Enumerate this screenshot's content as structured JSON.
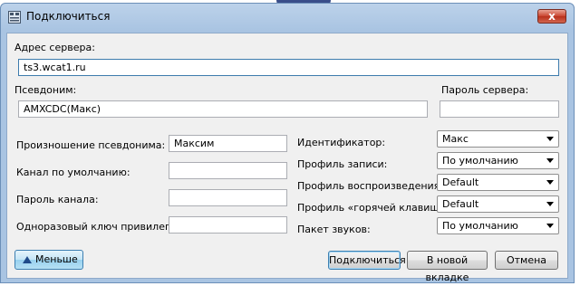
{
  "window": {
    "title": "Подключиться",
    "close_symbol": "x"
  },
  "server_address": {
    "label": "Адрес сервера:",
    "value": "ts3.wcat1.ru"
  },
  "nickname": {
    "label": "Псевдоним:",
    "value": "AMXCDC(Макс)"
  },
  "server_password": {
    "label": "Пароль сервера:",
    "value": ""
  },
  "left_fields": [
    {
      "label": "Произношение псевдонима:",
      "value": "Максим"
    },
    {
      "label": "Канал по умолчанию:",
      "value": ""
    },
    {
      "label": "Пароль канала:",
      "value": ""
    },
    {
      "label": "Одноразовый ключ привилегии:",
      "value": ""
    }
  ],
  "right_fields": [
    {
      "label": "Идентификатор:",
      "value": "Макс"
    },
    {
      "label": "Профиль записи:",
      "value": "По умолчанию"
    },
    {
      "label": "Профиль воспроизведения:",
      "value": "Default"
    },
    {
      "label": "Профиль «горячей клавиши»:",
      "value": "Default"
    },
    {
      "label": "Пакет звуков:",
      "value": "По умолчанию"
    }
  ],
  "buttons": {
    "less": "Меньше",
    "connect": "Подключиться",
    "new_tab": "В новой вкладке",
    "cancel": "Отмена"
  }
}
